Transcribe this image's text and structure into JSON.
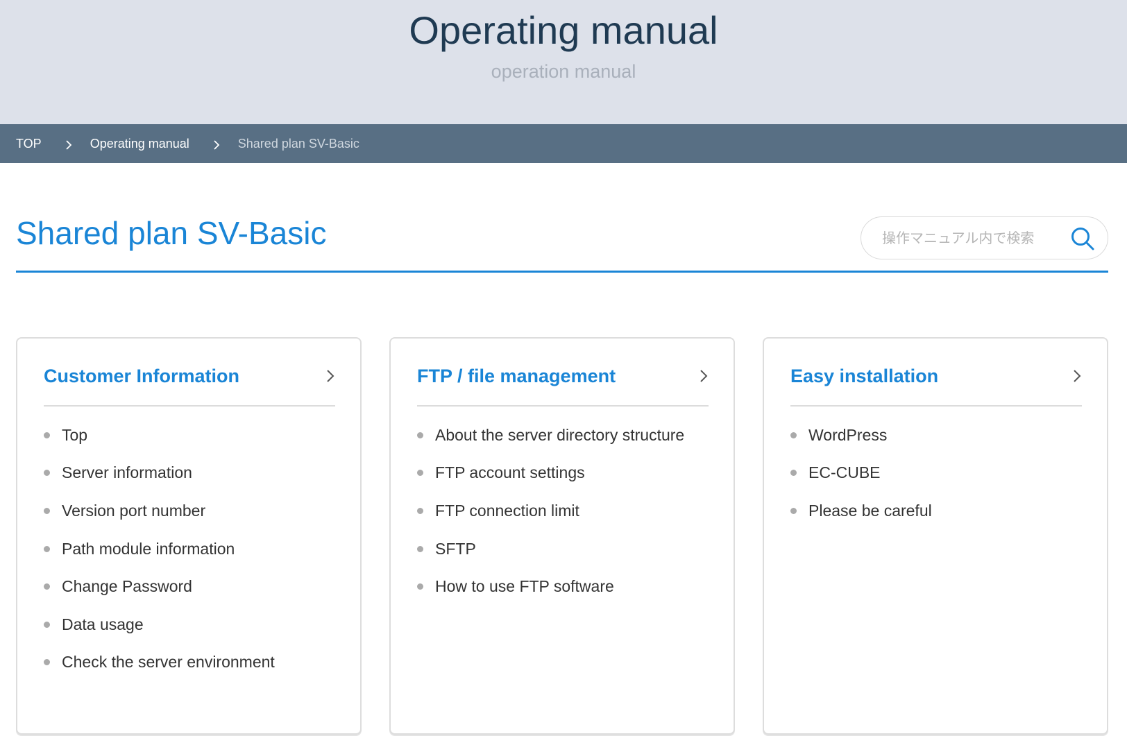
{
  "hero": {
    "title": "Operating manual",
    "subtitle": "operation manual"
  },
  "breadcrumb": {
    "items": [
      {
        "label": "TOP"
      },
      {
        "label": "Operating manual"
      },
      {
        "label": "Shared plan SV-Basic"
      }
    ],
    "separator_icon": "chevron-right-icon"
  },
  "page": {
    "title": "Shared plan SV-Basic"
  },
  "search": {
    "placeholder": "操作マニュアル内で検索",
    "value": "",
    "icon": "search-icon"
  },
  "colors": {
    "accent": "#1a85d6",
    "hero_bg": "#dde1ea",
    "breadcrumb_bg": "#586f84",
    "hero_title": "#1f3a52"
  },
  "cards": [
    {
      "title": "Customer Information",
      "items": [
        "Top",
        "Server information",
        "Version port number",
        "Path module information",
        "Change Password",
        "Data usage",
        "Check the server environment"
      ]
    },
    {
      "title": "FTP / file management",
      "items": [
        "About the server directory structure",
        "FTP account settings",
        "FTP connection limit",
        "SFTP",
        "How to use FTP software"
      ]
    },
    {
      "title": "Easy installation",
      "items": [
        "WordPress",
        "EC-CUBE",
        "Please be careful"
      ]
    }
  ]
}
